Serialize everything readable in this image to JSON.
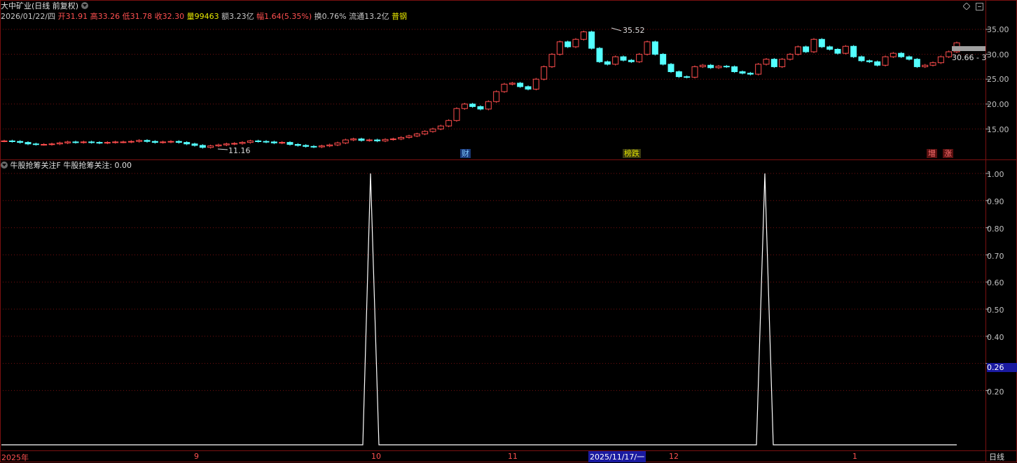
{
  "header": {
    "stock_title": "大中矿业(日线 前复权)",
    "date": "2026/01/22/四",
    "open_label": "开",
    "open": "31.91",
    "high_label": "高",
    "high": "33.26",
    "low_label": "低",
    "low": "31.78",
    "close_label": "收",
    "close": "32.30",
    "volume_label": "量",
    "volume": "99463",
    "amount_label": "额",
    "amount": "3.23亿",
    "change_label": "幅",
    "change": "1.64(5.35%)",
    "turnover_label": "换",
    "turnover": "0.76%",
    "float_label": "流通",
    "float": "13.2亿",
    "category": "普钢"
  },
  "price_axis": {
    "ticks": [
      "35.00",
      "30.00",
      "25.00",
      "20.00",
      "15.00"
    ]
  },
  "price_annotations": {
    "high_marker": "35.52",
    "low_marker": "11.16",
    "current_price_box": "30.66 - 3"
  },
  "event_tags": [
    {
      "label": "财",
      "color": "#5ab4ff"
    },
    {
      "label": "榜跌",
      "color": "#d8d800"
    },
    {
      "label": "增",
      "color": "#ff5050"
    },
    {
      "label": "涨",
      "color": "#ff5050"
    }
  ],
  "indicator": {
    "title": "牛股抢筹关注F",
    "value_label": "牛股抢筹关注: 0.00",
    "axis_ticks": [
      "1.00",
      "0.90",
      "0.80",
      "0.70",
      "0.60",
      "0.50",
      "0.40",
      "0.26",
      "0.20"
    ],
    "current_value_box": "0.26",
    "spikes": [
      1,
      1
    ]
  },
  "time_axis": {
    "labels": [
      "2025年",
      "9",
      "10",
      "11",
      "2025/11/17/一",
      "12",
      "1"
    ],
    "period_button": "日线"
  },
  "colors": {
    "up": "#ff4d4d",
    "down": "#54ffff",
    "grid": "#7a1010",
    "line": "#ffffff",
    "cursor_box": "#1a1aa0"
  },
  "icons": [
    "chevron-down-icon",
    "diamond-icon",
    "collapse-icon"
  ]
}
